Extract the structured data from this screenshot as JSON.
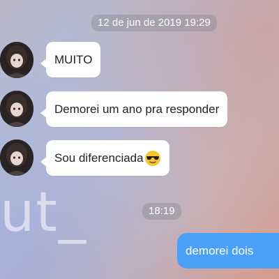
{
  "chat": {
    "date_chip": "12 de jun de 2019 19:29",
    "time_chip": "18:19",
    "messages": [
      {
        "text": "MUITO"
      },
      {
        "text": "Demorei um ano pra responder"
      },
      {
        "text": "Sou diferenciada",
        "emoji": "sunglasses-emoji"
      }
    ],
    "outgoing": {
      "text": "demorei dois"
    }
  },
  "watermark": {
    "text": "ut_"
  },
  "colors": {
    "incoming_bubble": "#ffffff",
    "outgoing_bubble": "#4aa0f6",
    "chip": "#8c8c96"
  }
}
